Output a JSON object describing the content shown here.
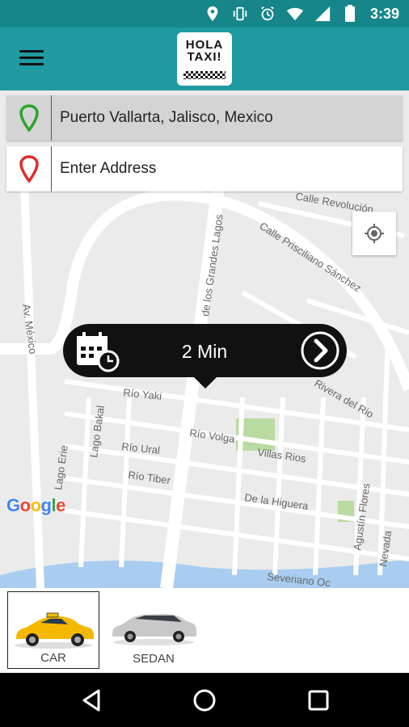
{
  "status_bar": {
    "time": "3:39",
    "icons": [
      "location-icon",
      "vibrate-icon",
      "alarm-icon",
      "wifi-icon",
      "signal-icon",
      "battery-icon"
    ]
  },
  "app_bar": {
    "logo_line1": "HOLA",
    "logo_line2": "TAXI!",
    "menu_icon": "hamburger-menu-icon"
  },
  "route": {
    "pickup_address": "Puerto Vallarta, Jalisco, Mexico",
    "destination_placeholder": "Enter Address",
    "pickup_pin_color": "#2aa52a",
    "destination_pin_color": "#e02b2b"
  },
  "map": {
    "streets": [
      "Calle Revolución",
      "Calle Prisciliano Sánchez",
      "de los Grandes Lagos",
      "Av. México",
      "Rivera del Rio",
      "Río Yaki",
      "Lago Bakal",
      "Río Volga",
      "Villas Rios",
      "Río Ural",
      "Lago Erie",
      "Río Tiber",
      "De la Higuera",
      "Agustín Flores",
      "Nevada",
      "Severiano Oc"
    ],
    "attribution": "Google",
    "locate_icon": "my-location-icon"
  },
  "eta_bubble": {
    "eta": "2 Min",
    "schedule_icon": "calendar-clock-icon",
    "next_icon": "chevron-right-circle-icon"
  },
  "vehicle_options": [
    {
      "label": "CAR",
      "selected": true,
      "color": "#f5b800"
    },
    {
      "label": "SEDAN",
      "selected": false,
      "color": "#c8c8c8"
    }
  ],
  "colors": {
    "status_bar": "#16868b",
    "app_bar": "#1e9aa0",
    "accent_black": "#111111"
  }
}
